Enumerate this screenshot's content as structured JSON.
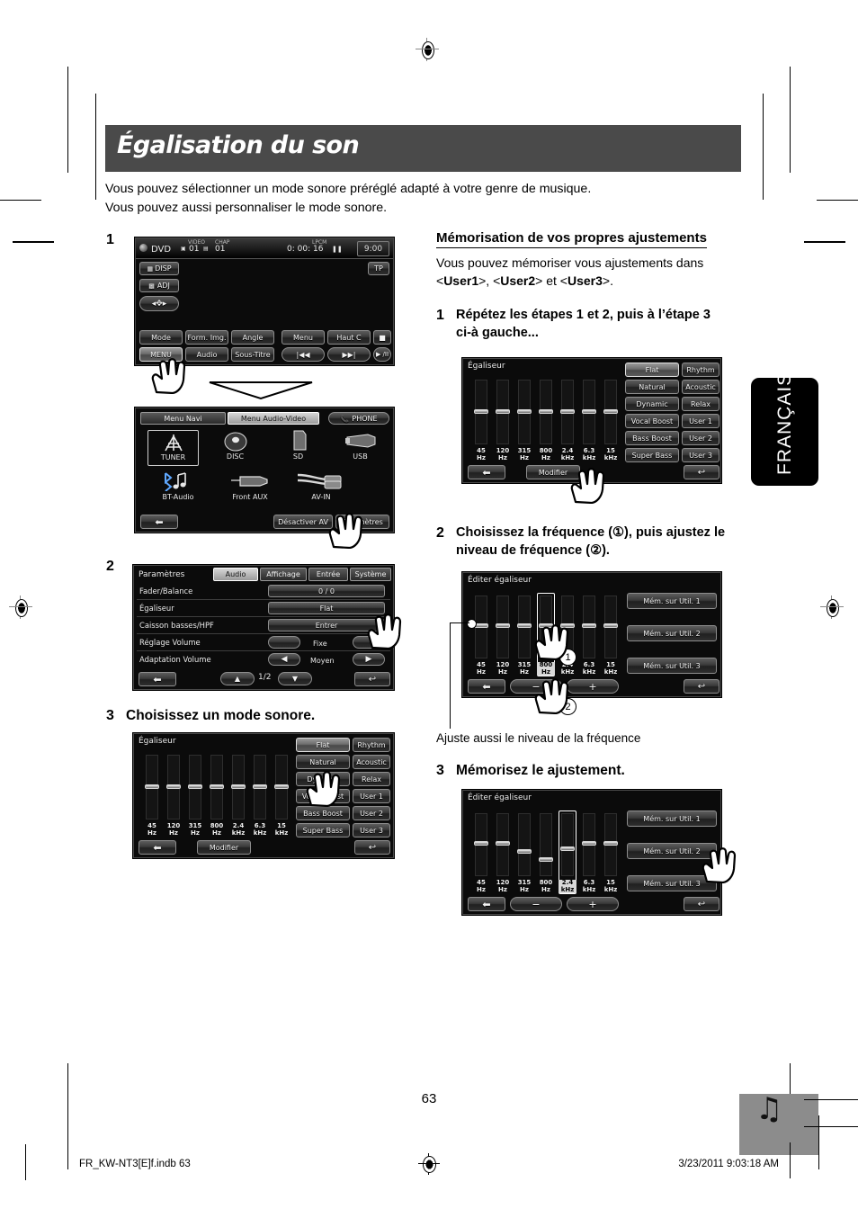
{
  "page": {
    "title": "Égalisation du son",
    "intro_lines": [
      "Vous pouvez sélectionner un mode sonore préréglé adapté à votre genre de musique.",
      "Vous pouvez aussi personnaliser le mode sonore."
    ],
    "number": "63",
    "side_tab": "FRANÇAIS",
    "footer_left": "FR_KW-NT3[E]f.indb   63",
    "footer_right": "3/23/2011   9:03:18 AM",
    "footer_icon": "music-note-icon"
  },
  "left_column": {
    "step1": {
      "num": "1"
    },
    "step2": {
      "num": "2"
    },
    "step3": {
      "num": "3",
      "text": "Choisissez un mode sonore."
    }
  },
  "right_column": {
    "heading": "Mémorisation de vos propres ajustements",
    "intro_a": "Vous pouvez mémoriser vous ajustements dans",
    "intro_b_pre": "<",
    "intro_u1": "User1",
    "intro_mid": ">, <",
    "intro_u2": "User2",
    "intro_mid2": "> et <",
    "intro_u3": "User3",
    "intro_end": ">.",
    "step1": {
      "num": "1",
      "line1": "Répétez les étapes 1 et 2, puis à l’étape 3",
      "line2": "ci-à gauche..."
    },
    "step2": {
      "num": "2",
      "line1": "Choisissez la fréquence (①), puis ajustez le",
      "line2": "niveau de fréquence (②)."
    },
    "note": "Ajuste aussi le niveau de la fréquence",
    "step3": {
      "num": "3",
      "text": "Mémorisez le ajustement."
    },
    "callout1": "①",
    "callout2": "②"
  },
  "screens": {
    "dvd": {
      "source": "DVD",
      "video_label": "VIDEO",
      "video_value": "01",
      "chap_label": "CHAP",
      "chap_value": "01",
      "audio_format": "LPCM",
      "time": "0: 00: 16",
      "clock": "9:00",
      "disp": "DISP",
      "adj": "ADJ",
      "tp": "TP",
      "buttons_row1": [
        "Mode",
        "Form. Img.",
        "Angle",
        "Menu",
        "Haut C",
        "■"
      ],
      "buttons_row2": [
        "MENU",
        "Audio",
        "Sous-Titre",
        "|◀◀",
        "▶▶|",
        "▶ /II"
      ],
      "highlighted": "MENU"
    },
    "menu": {
      "tabs": [
        "Menu Navi",
        "Menu Audio-Video"
      ],
      "active_tab": "Menu Audio-Video",
      "phone": "PHONE",
      "sources_row1": [
        "TUNER",
        "DISC",
        "SD",
        "USB"
      ],
      "sources_row2": [
        "BT-Audio",
        "Front AUX",
        "AV-IN"
      ],
      "selected_source": "TUNER",
      "deactivate_av": "Désactiver AV",
      "settings": "Paramètres",
      "back_icon": "back-arrow-icon"
    },
    "settings": {
      "title": "Paramètres",
      "tabs": [
        "Audio",
        "Affichage",
        "Entrée",
        "Système"
      ],
      "active_tab": "Audio",
      "rows": [
        {
          "name": "Fader/Balance",
          "value": "0 / 0"
        },
        {
          "name": "Égaliseur",
          "value": "Flat"
        },
        {
          "name": "Caisson basses/HPF",
          "value": "Entrer"
        },
        {
          "name": "Réglage Volume",
          "value": "Fixe"
        },
        {
          "name": "Adaptation Volume",
          "value": "Moyen"
        }
      ],
      "page_indicator": "1/2",
      "back_icon": "back-arrow-icon",
      "up_icon": "up-arrow-icon",
      "down_icon": "down-arrow-icon",
      "exit_icon": "exit-icon"
    },
    "equalizer": {
      "title": "Égaliseur",
      "presets_col1": [
        "Flat",
        "Natural",
        "Dynamic",
        "Vocal Boost",
        "Bass Boost",
        "Super Bass"
      ],
      "presets_col2": [
        "Rhythm",
        "Acoustic",
        "Relax",
        "User 1",
        "User 2",
        "User 3"
      ],
      "selected_preset": "Flat",
      "modify": "Modifier",
      "back_icon": "back-arrow-icon",
      "exit_icon": "exit-icon",
      "bands": [
        {
          "label_top": "45",
          "label_bot": "Hz"
        },
        {
          "label_top": "120",
          "label_bot": "Hz"
        },
        {
          "label_top": "315",
          "label_bot": "Hz"
        },
        {
          "label_top": "800",
          "label_bot": "Hz"
        },
        {
          "label_top": "2.4",
          "label_bot": "kHz"
        },
        {
          "label_top": "6.3",
          "label_bot": "kHz"
        },
        {
          "label_top": "15",
          "label_bot": "kHz"
        }
      ],
      "levels_flat": [
        0,
        0,
        0,
        0,
        0,
        0,
        0
      ]
    },
    "editor": {
      "title": "Éditer égaliseur",
      "memory_buttons": [
        "Mém. sur Util. 1",
        "Mém. sur Util. 2",
        "Mém. sur Util. 3"
      ],
      "minus": "−",
      "plus": "+",
      "back_icon": "back-arrow-icon",
      "exit_icon": "exit-icon",
      "step2_selected_band": "800 Hz",
      "step2_levels": [
        0,
        0,
        0,
        0,
        0,
        0,
        0
      ],
      "step3_selected_band": "2.4 kHz",
      "step3_levels": [
        0,
        0,
        -2,
        -4,
        -1,
        0,
        0
      ]
    }
  }
}
